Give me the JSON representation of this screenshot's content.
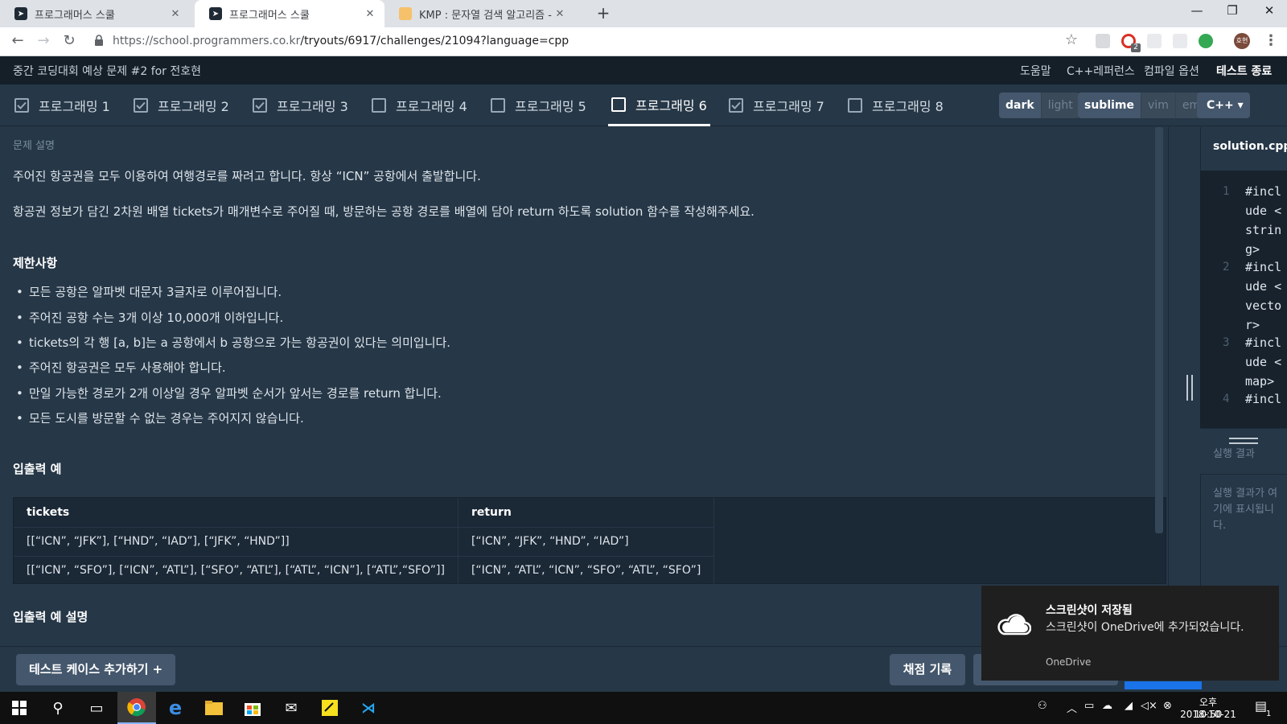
{
  "browser": {
    "tabs": [
      {
        "title": "프로그래머스 스쿨",
        "active": false
      },
      {
        "title": "프로그래머스 스쿨",
        "active": true
      },
      {
        "title": "KMP : 문자열 검색 알고리즘 - 5",
        "active": false
      }
    ],
    "url_host": "https://school.programmers.co.kr",
    "url_path": "/tryouts/6917/challenges/21094?language=cpp",
    "profile_initial": "호현",
    "ext_badge": "2"
  },
  "header": {
    "title": "중간 코딩대회 예상 문제 #2 for 전호현",
    "links": [
      "도움말",
      "C++레퍼런스",
      "컴파일 옵션"
    ],
    "end_test": "테스트 종료"
  },
  "problem_tabs": [
    {
      "label": "프로그래밍 1",
      "checked": true
    },
    {
      "label": "프로그래밍 2",
      "checked": true
    },
    {
      "label": "프로그래밍 3",
      "checked": true
    },
    {
      "label": "프로그래밍 4",
      "checked": false
    },
    {
      "label": "프로그래밍 5",
      "checked": false
    },
    {
      "label": "프로그래밍 6",
      "checked": false,
      "current": true
    },
    {
      "label": "프로그래밍 7",
      "checked": true
    },
    {
      "label": "프로그래밍 8",
      "checked": false
    }
  ],
  "settings": {
    "theme": [
      "dark",
      "light"
    ],
    "keymap": [
      "sublime",
      "vim",
      "emacs"
    ],
    "language": "C++"
  },
  "problem": {
    "section_label": "문제 설명",
    "intro": "주어진 항공권을 모두 이용하여 여행경로를 짜려고 합니다. 항상 “ICN” 공항에서 출발합니다.",
    "task": "항공권 정보가 담긴 2차원 배열 tickets가 매개변수로 주어질 때, 방문하는 공항 경로를 배열에 담아 return 하도록 solution 함수를 작성해주세요.",
    "constraints_title": "제한사항",
    "constraints": [
      "모든 공항은 알파벳 대문자 3글자로 이루어집니다.",
      "주어진 공항 수는 3개 이상 10,000개 이하입니다.",
      "tickets의 각 행 [a, b]는 a 공항에서 b 공항으로 가는 항공권이 있다는 의미입니다.",
      "주어진 항공권은 모두 사용해야 합니다.",
      "만일 가능한 경로가 2개 이상일 경우 알파벳 순서가 앞서는 경로를 return 합니다.",
      "모든 도시를 방문할 수 없는 경우는 주어지지 않습니다."
    ],
    "io_title": "입출력 예",
    "table_headers": [
      "tickets",
      "return"
    ],
    "table_rows": [
      [
        "[[“ICN”, “JFK”], [“HND”, “IAD”], [“JFK”, “HND”]]",
        "[“ICN”, “JFK”, “HND”, “IAD”]"
      ],
      [
        "[[“ICN”, “SFO”], [“ICN”, “ATL”], [“SFO”, “ATL”], [“ATL”, “ICN”], [“ATL”,“SFO”]]",
        "[“ICN”, “ATL”, “ICN”, “SFO”, “ATL”, “SFO”]"
      ]
    ],
    "io_explain_title": "입출력 예 설명"
  },
  "editor": {
    "file_name": "solution.cpp",
    "lines": [
      {
        "num": "1",
        "text": "#include <string>"
      },
      {
        "num": "2",
        "text": "#include <vector>"
      },
      {
        "num": "3",
        "text": "#include <map>"
      },
      {
        "num": "4",
        "text": "#incl"
      }
    ],
    "result_label": "실행 결과",
    "result_placeholder": "실행 결과가 여기에 표시됩니다."
  },
  "actions": {
    "add_testcase": "테스트 케이스 추가하기 +",
    "grading_log": "채점 기록"
  },
  "toast": {
    "title": "스크린샷이 저장됨",
    "body": "스크린샷이 OneDrive에 추가되었습니다.",
    "source": "OneDrive"
  },
  "taskbar": {
    "time": "오후 10:50",
    "date": "2018-10-21",
    "notification_count": "1"
  }
}
